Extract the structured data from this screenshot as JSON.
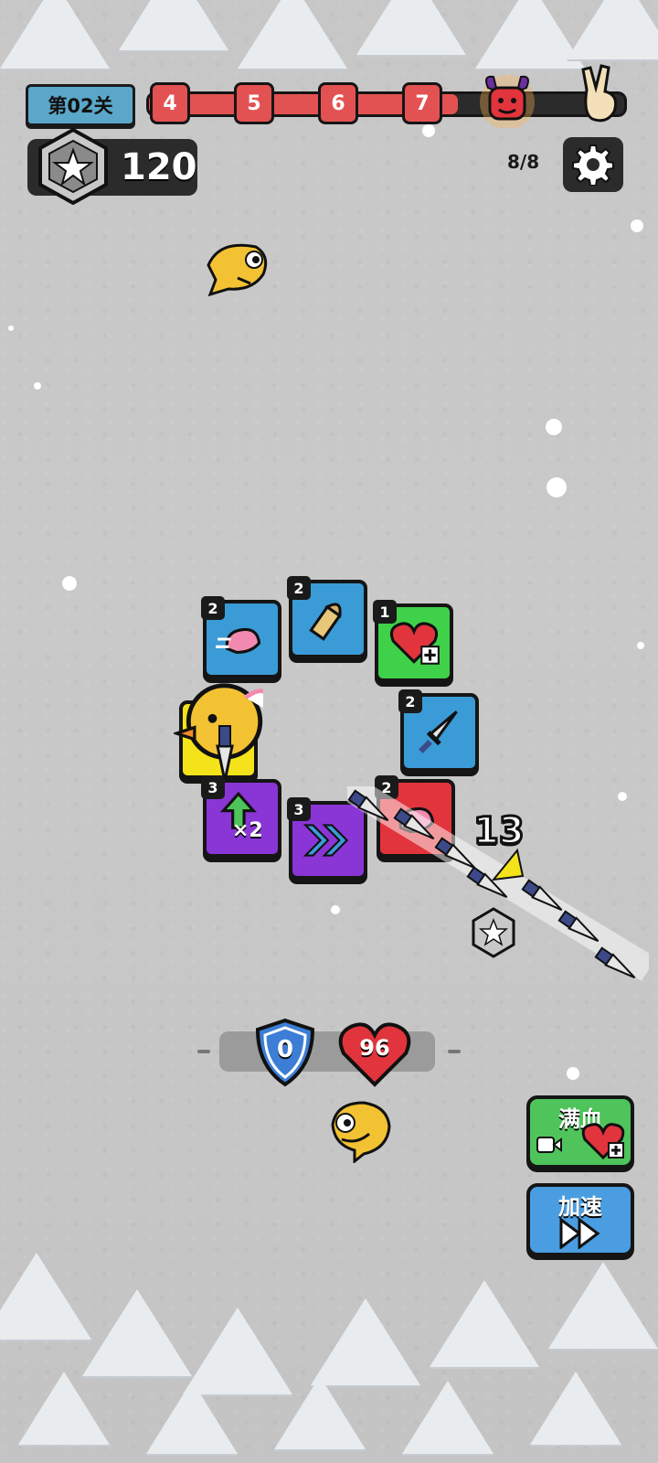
{
  "hud": {
    "level_label": "第02关",
    "wave_nodes": [
      "4",
      "5",
      "6",
      "7"
    ],
    "coins": "120",
    "wave_count": "8/8",
    "progress_fraction": 0.65
  },
  "cards": [
    {
      "id": "wind-shoe",
      "level": "2",
      "color": "blue"
    },
    {
      "id": "bullet",
      "level": "2",
      "color": "blue"
    },
    {
      "id": "heal",
      "level": "1",
      "color": "green"
    },
    {
      "id": "knife",
      "level": "2",
      "color": "blue"
    },
    {
      "id": "double",
      "level": "3",
      "color": "purple",
      "text": "×2"
    },
    {
      "id": "speed",
      "level": "3",
      "color": "purple"
    },
    {
      "id": "boot",
      "level": "2",
      "color": "red"
    }
  ],
  "combat": {
    "damage_number": "13"
  },
  "player": {
    "shield": "0",
    "health": "96"
  },
  "buttons": {
    "full_heal_label": "满血",
    "speed_up_label": "加速"
  },
  "icons": [
    "star-coin-icon",
    "gear-icon",
    "boss-devil-icon",
    "victory-hand-icon",
    "heart-icon",
    "shield-icon",
    "video-icon",
    "fast-forward-icon",
    "dagger-icon"
  ],
  "colors": {
    "bar_red": "#e35252",
    "card_blue": "#3a9bd6",
    "card_green": "#3fd14a",
    "card_purple": "#8a35d6",
    "card_red": "#e2343c",
    "card_yellow": "#f4e21a",
    "btn_green": "#4ec45a",
    "btn_blue": "#4a9de0"
  }
}
